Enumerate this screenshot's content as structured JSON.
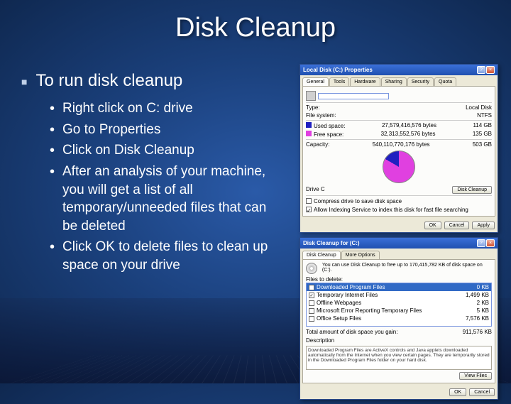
{
  "title": "Disk Cleanup",
  "heading": "To run disk cleanup",
  "steps": [
    "Right click on C: drive",
    "Go to Properties",
    "Click on Disk Cleanup",
    "After an analysis of your machine, you will get a list of all temporary/unneeded files that can be deleted",
    "Click OK to delete files to clean up space on your drive"
  ],
  "properties_dialog": {
    "title": "Local Disk (C:) Properties",
    "tabs": [
      "General",
      "Tools",
      "Hardware",
      "Sharing",
      "Security",
      "Quota"
    ],
    "active_tab": "General",
    "type_label": "Type:",
    "type_value": "Local Disk",
    "fs_label": "File system:",
    "fs_value": "NTFS",
    "used_label": "Used space:",
    "used_bytes": "27,579,416,576 bytes",
    "used_gb": "114 GB",
    "free_label": "Free space:",
    "free_bytes": "32,313,552,576 bytes",
    "free_gb": "135 GB",
    "capacity_label": "Capacity:",
    "capacity_bytes": "540,110,770,176 bytes",
    "capacity_gb": "503 GB",
    "drive_label": "Drive C",
    "cleanup_btn": "Disk Cleanup",
    "compress_text": "Compress drive to save disk space",
    "index_text": "Allow Indexing Service to index this disk for fast file searching",
    "ok": "OK",
    "cancel": "Cancel",
    "apply": "Apply"
  },
  "cleanup_dialog": {
    "title": "Disk Cleanup for (C:)",
    "tabs": [
      "Disk Cleanup",
      "More Options"
    ],
    "active_tab": "Disk Cleanup",
    "summary": "You can use Disk Cleanup to free up to 170,415,782 KB of disk space on (C:).",
    "files_label": "Files to delete:",
    "items": [
      {
        "checked": true,
        "name": "Downloaded Program Files",
        "size": "0 KB",
        "selected": true
      },
      {
        "checked": true,
        "name": "Temporary Internet Files",
        "size": "1,499 KB"
      },
      {
        "checked": false,
        "name": "Offline Webpages",
        "size": "2 KB"
      },
      {
        "checked": false,
        "name": "Microsoft Error Reporting Temporary Files",
        "size": "5 KB"
      },
      {
        "checked": false,
        "name": "Office Setup Files",
        "size": "7,576 KB"
      }
    ],
    "total_label": "Total amount of disk space you gain:",
    "total_value": "911,576 KB",
    "desc_label": "Description",
    "desc_text": "Downloaded Program Files are ActiveX controls and Java applets downloaded automatically from the Internet when you view certain pages. They are temporarily stored in the Downloaded Program Files folder on your hard disk.",
    "view_btn": "View Files",
    "ok": "OK",
    "cancel": "Cancel"
  }
}
